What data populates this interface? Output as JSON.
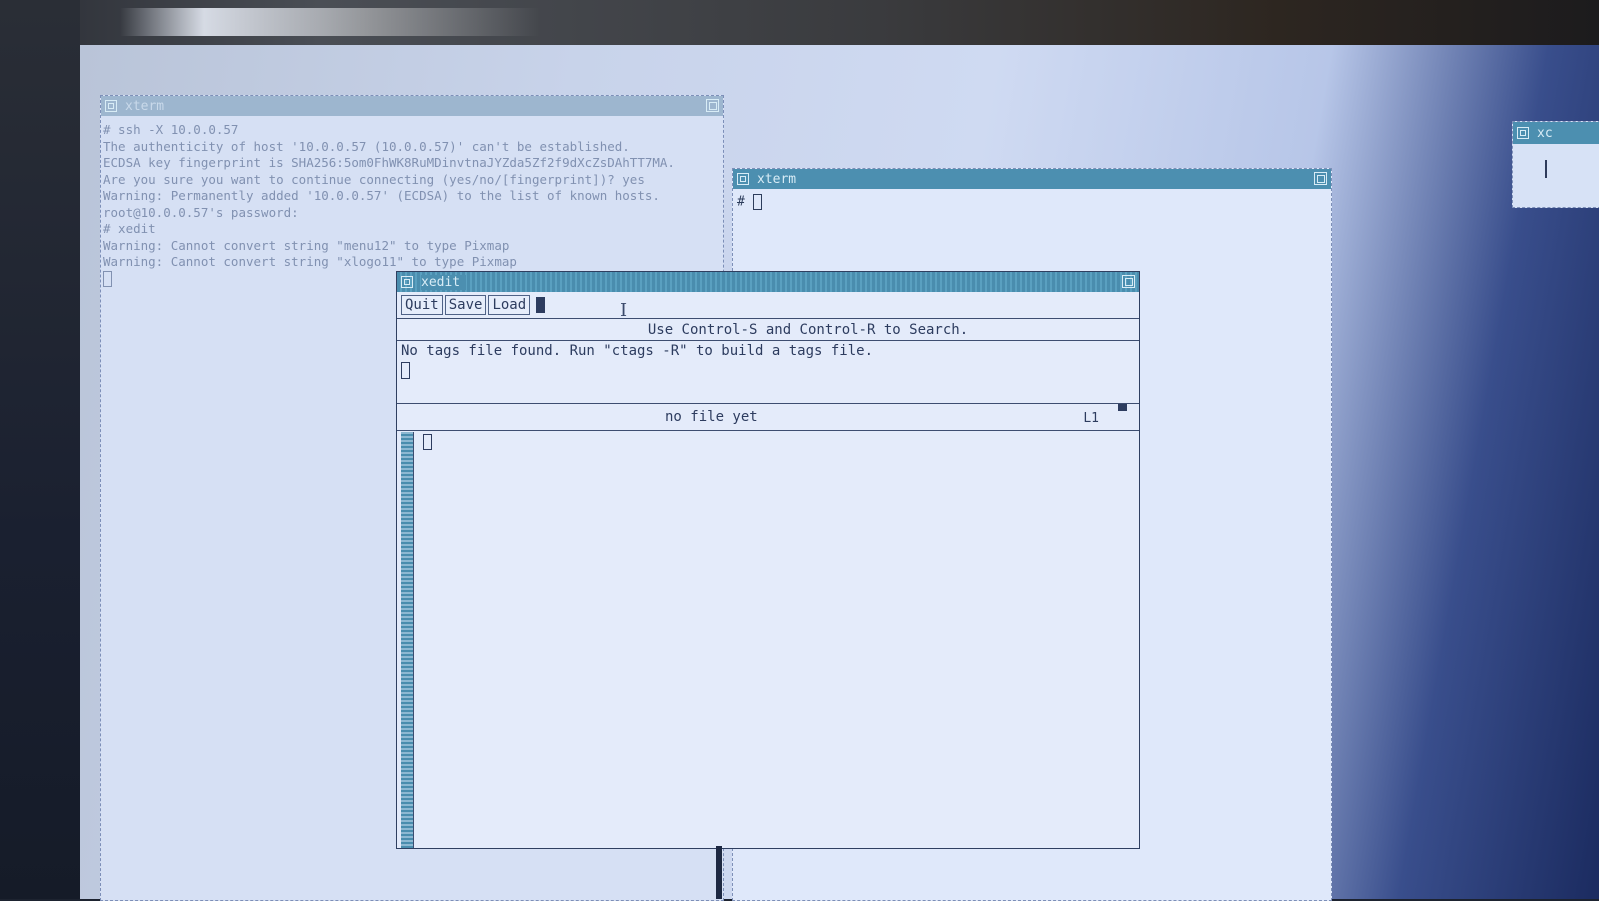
{
  "background_terminal": {
    "title": "xterm",
    "lines": [
      "# ssh -X 10.0.0.57",
      "The authenticity of host '10.0.0.57 (10.0.0.57)' can't be established.",
      "ECDSA key fingerprint is SHA256:5om0FhWK8RuMDinvtnaJYZda5Zf2f9dXcZsDAhTT7MA.",
      "Are you sure you want to continue connecting (yes/no/[fingerprint])? yes",
      "Warning: Permanently added '10.0.0.57' (ECDSA) to the list of known hosts.",
      "root@10.0.0.57's password:",
      "# xedit",
      "Warning: Cannot convert string \"menu12\" to type Pixmap",
      "Warning: Cannot convert string \"xlogo11\" to type Pixmap"
    ]
  },
  "xterm": {
    "title": "xterm",
    "prompt": "#"
  },
  "right_window": {
    "title": "xc"
  },
  "xedit": {
    "title": "xedit",
    "buttons": {
      "quit": "Quit",
      "save": "Save",
      "load": "Load"
    },
    "hint": "Use Control-S and Control-R to Search.",
    "message": "No tags file found. Run \"ctags -R\" to build a tags file.",
    "status": "no file yet",
    "line_number": "L1"
  },
  "colors": {
    "titlebar": "#4c8fb0",
    "window_bg": "#e4ebfa",
    "text": "#2d3c5f"
  }
}
